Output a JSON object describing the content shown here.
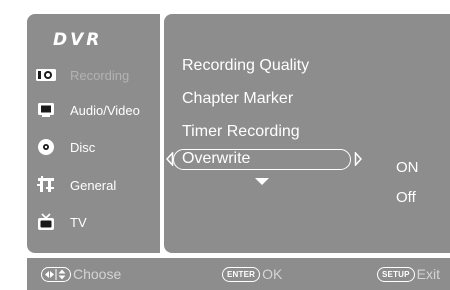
{
  "header": {
    "title": "DVR"
  },
  "sidebar": {
    "items": [
      {
        "label": "Recording",
        "icon": "recording-camera-icon",
        "active": true
      },
      {
        "label": "Audio/Video",
        "icon": "monitor-icon"
      },
      {
        "label": "Disc",
        "icon": "disc-icon"
      },
      {
        "label": "General",
        "icon": "general-settings-icon"
      },
      {
        "label": "TV",
        "icon": "tv-icon"
      }
    ]
  },
  "main": {
    "items": [
      {
        "label": "Recording Quality"
      },
      {
        "label": "Chapter Marker"
      },
      {
        "label": "Timer Recording"
      },
      {
        "label": "Overwrite",
        "selected": true
      }
    ],
    "options": [
      {
        "label": "ON"
      },
      {
        "label": "Off"
      }
    ]
  },
  "footer": {
    "choose": {
      "label": "Choose",
      "icon": "navigation-arrows-icon"
    },
    "ok": {
      "key": "ENTER",
      "label": "OK"
    },
    "exit": {
      "key": "SETUP",
      "label": "Exit"
    }
  },
  "colors": {
    "panel": "#8d8d8d",
    "text": "#ffffff",
    "inactive_text": "#b3b3b3",
    "footer_text": "#d4d4d4"
  }
}
